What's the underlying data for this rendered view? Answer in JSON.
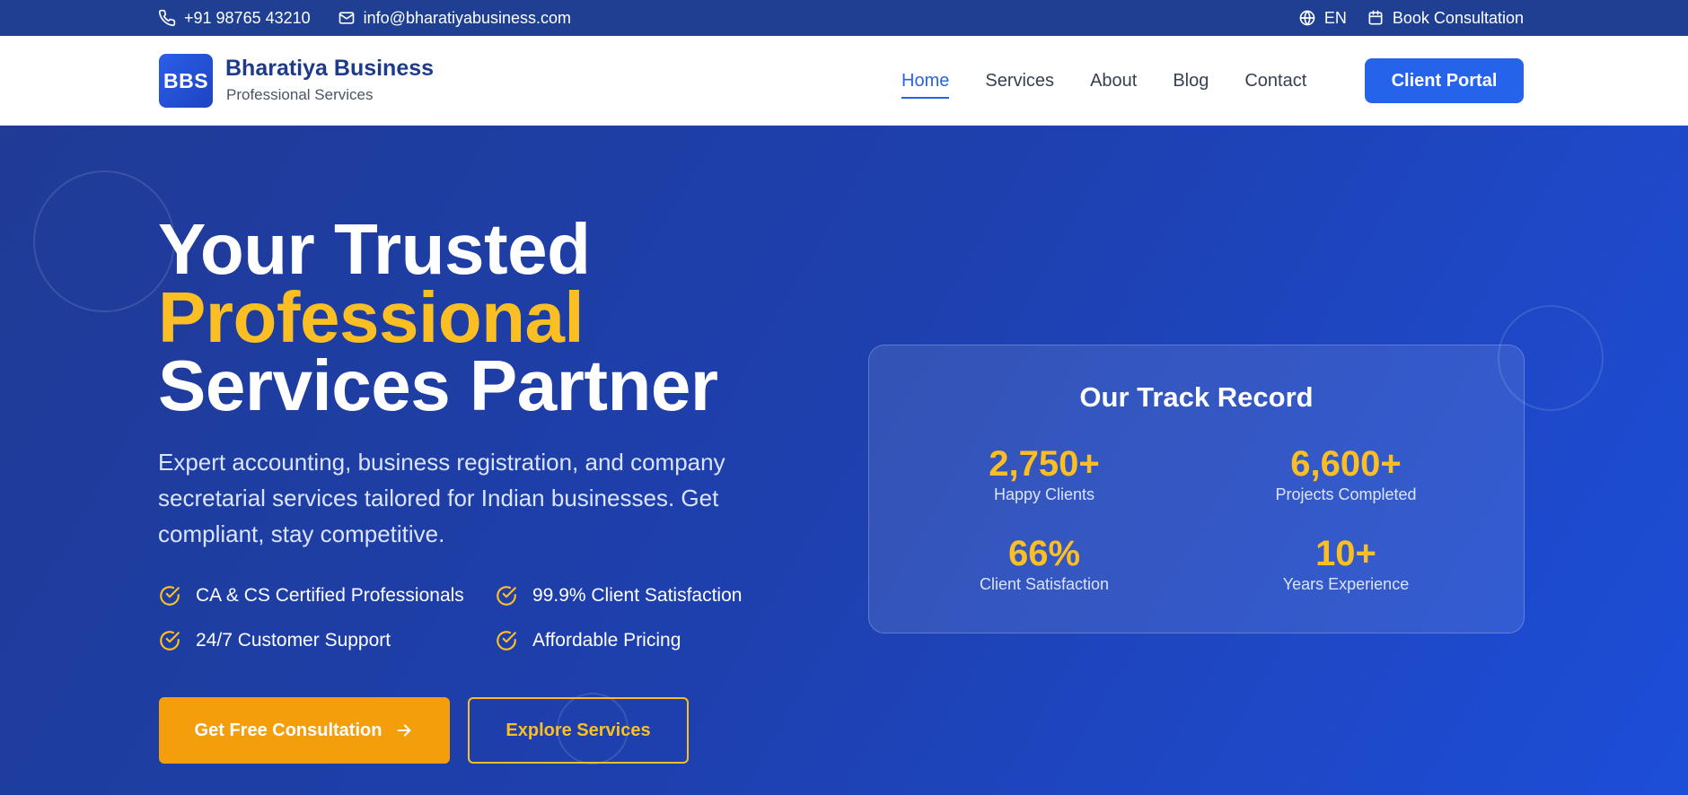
{
  "topbar": {
    "phone": "+91 98765 43210",
    "email": "info@bharatiyabusiness.com",
    "language": "EN",
    "book_label": "Book Consultation"
  },
  "header": {
    "logo_text": "BBS",
    "brand_name": "Bharatiya Business",
    "brand_sub": "Professional Services",
    "nav": [
      {
        "label": "Home",
        "active": true
      },
      {
        "label": "Services",
        "active": false
      },
      {
        "label": "About",
        "active": false
      },
      {
        "label": "Blog",
        "active": false
      },
      {
        "label": "Contact",
        "active": false
      }
    ],
    "portal_label": "Client Portal"
  },
  "hero": {
    "headline_line1": "Your Trusted",
    "headline_line2": "Professional",
    "headline_line3": "Services Partner",
    "lead": "Expert accounting, business registration, and company secretarial services tailored for Indian businesses. Get compliant, stay competitive.",
    "features": [
      "CA & CS Certified Professionals",
      "99.9% Client Satisfaction",
      "24/7 Customer Support",
      "Affordable Pricing"
    ],
    "cta_primary": "Get Free Consultation",
    "cta_secondary": "Explore Services"
  },
  "stats": {
    "title": "Our Track Record",
    "items": [
      {
        "value": "2,750+",
        "label": "Happy Clients"
      },
      {
        "value": "6,600+",
        "label": "Projects Completed"
      },
      {
        "value": "66%",
        "label": "Client Satisfaction"
      },
      {
        "value": "10+",
        "label": "Years Experience"
      }
    ]
  },
  "colors": {
    "topbar": "#1f3f93",
    "primary": "#2563eb",
    "accent": "#fbbf24",
    "cta": "#f59e0b",
    "brand_text": "#1e3a8a"
  },
  "icons": [
    "phone-icon",
    "mail-icon",
    "globe-icon",
    "calendar-icon",
    "check-circle-icon",
    "arrow-right-icon"
  ]
}
